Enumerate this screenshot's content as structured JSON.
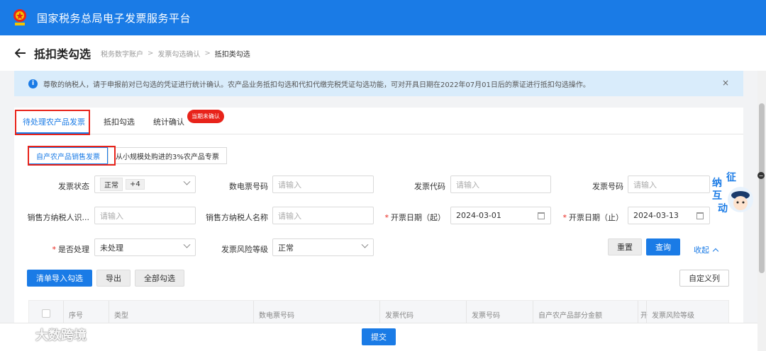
{
  "topbar": {
    "title": "国家税务总局电子发票服务平台"
  },
  "header": {
    "page_title": "抵扣类勾选",
    "breadcrumb": [
      "税务数字账户",
      "发票勾选确认",
      "抵扣类勾选"
    ],
    "sep": ">"
  },
  "notice": {
    "text": "尊敬的纳税人，请于申报前对已勾选的凭证进行统计确认。农产品业务抵扣勾选和代扣代缴完税凭证勾选功能，可对开具日期在2022年07月01日后的票证进行抵扣勾选操作。",
    "close": "×"
  },
  "tabs": [
    {
      "label": "待处理农产品发票",
      "active": true
    },
    {
      "label": "抵扣勾选"
    },
    {
      "label": "统计确认"
    }
  ],
  "badge": "当期未确认",
  "subtabs": [
    {
      "label": "自产农产品销售发票",
      "active": true
    },
    {
      "label": "从小规模处购进的3%农产品专票"
    }
  ],
  "filters": {
    "invoice_status_label": "发票状态",
    "invoice_status_tags": [
      "正常",
      "+4"
    ],
    "e_invoice_no_label": "数电票号码",
    "invoice_code_label": "发票代码",
    "invoice_no_label": "发票号码",
    "seller_tax_id_label": "销售方纳税人识...",
    "seller_name_label": "销售方纳税人名称",
    "date_start_label": "开票日期（起）",
    "date_start_value": "2024-03-01",
    "date_end_label": "开票日期（止）",
    "date_end_value": "2024-03-13",
    "processed_label": "是否处理",
    "processed_value": "未处理",
    "risk_label": "发票风险等级",
    "risk_value": "正常",
    "placeholder": "请输入",
    "required_mark": "*"
  },
  "actions": {
    "reset": "重置",
    "query": "查询",
    "collapse": "收起",
    "import_select": "清单导入勾选",
    "export": "导出",
    "select_all": "全部勾选",
    "custom_columns": "自定义列",
    "submit": "提交"
  },
  "table": {
    "columns": [
      "序号",
      "类型",
      "数电票号码",
      "发票代码",
      "发票号码",
      "自产农产品部分金额",
      "开",
      "发票风险等级"
    ]
  },
  "mascot": {
    "chars": [
      "征",
      "纳",
      "互",
      "动"
    ]
  },
  "watermark": "大数跨境",
  "colors": {
    "brand": "#1a7be6",
    "alert": "#e8231a",
    "notice_bg": "#d9ecfb"
  }
}
